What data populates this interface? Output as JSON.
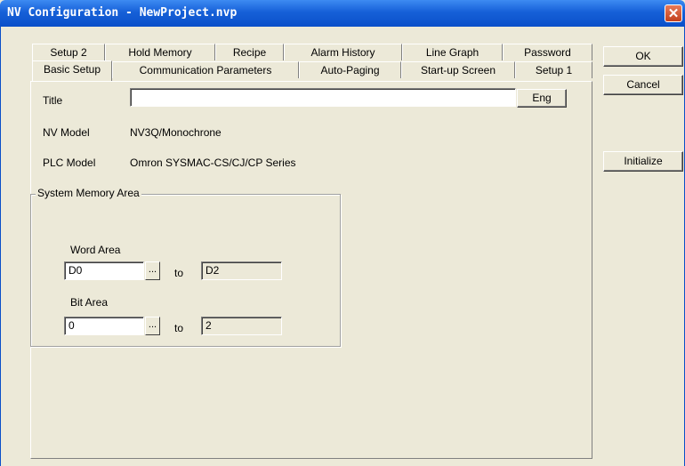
{
  "window": {
    "title": "NV Configuration - NewProject.nvp",
    "close_glyph": "✕"
  },
  "tabs_back": [
    "Setup 2",
    "Hold Memory",
    "Recipe",
    "Alarm History",
    "Line Graph",
    "Password"
  ],
  "tabs_front": [
    "Basic Setup",
    "Communication Parameters",
    "Auto-Paging",
    "Start-up Screen",
    "Setup 1"
  ],
  "basic_setup": {
    "title_label": "Title",
    "title_value": "",
    "eng_label": "Eng",
    "nv_model_label": "NV Model",
    "nv_model_value": "NV3Q/Monochrone",
    "plc_model_label": "PLC Model",
    "plc_model_value": "Omron SYSMAC-CS/CJ/CP Series",
    "system_memory": {
      "legend": "System Memory Area",
      "word_area_label": "Word Area",
      "word_area_from": "D0",
      "word_area_to": "D2",
      "bit_area_label": "Bit Area",
      "bit_area_from": "0",
      "bit_area_to": "2",
      "to_label": "to",
      "browse_label": "..."
    }
  },
  "buttons": {
    "ok": "OK",
    "cancel": "Cancel",
    "initialize": "Initialize"
  }
}
